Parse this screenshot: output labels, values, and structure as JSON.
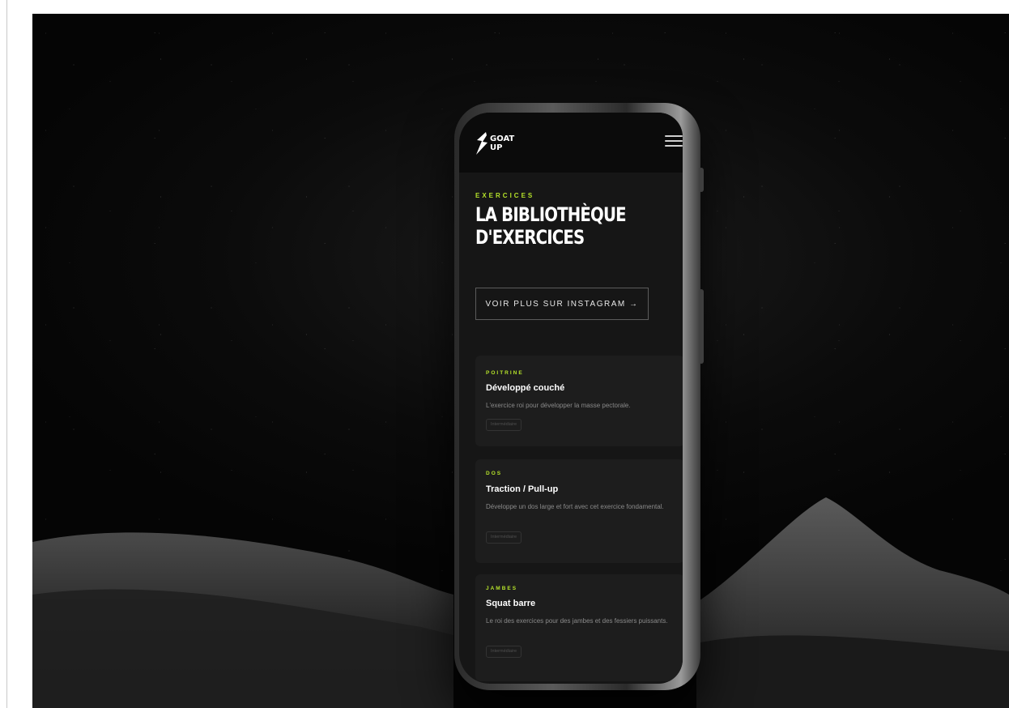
{
  "app": {
    "logo_line1": "GOAT",
    "logo_line2": "UP"
  },
  "page": {
    "eyebrow": "EXERCICES",
    "title_line1": "LA BIBLIOTHÈQUE",
    "title_line2": "D'EXERCICES",
    "cta_label": "VOIR PLUS SUR INSTAGRAM →"
  },
  "exercises": [
    {
      "category": "POITRINE",
      "name": "Développé couché",
      "description": "L'exercice roi pour développer la masse pectorale.",
      "level": "Intermédiaire"
    },
    {
      "category": "DOS",
      "name": "Traction / Pull-up",
      "description": "Développe un dos large et fort avec cet exercice fondamental.",
      "level": "Intermédiaire"
    },
    {
      "category": "JAMBES",
      "name": "Squat barre",
      "description": "Le roi des exercices pour des jambes et des fessiers puissants.",
      "level": "Intermédiaire"
    }
  ],
  "colors": {
    "accent": "#b6e32a",
    "background": "#161616",
    "card": "#1d1d1d"
  }
}
